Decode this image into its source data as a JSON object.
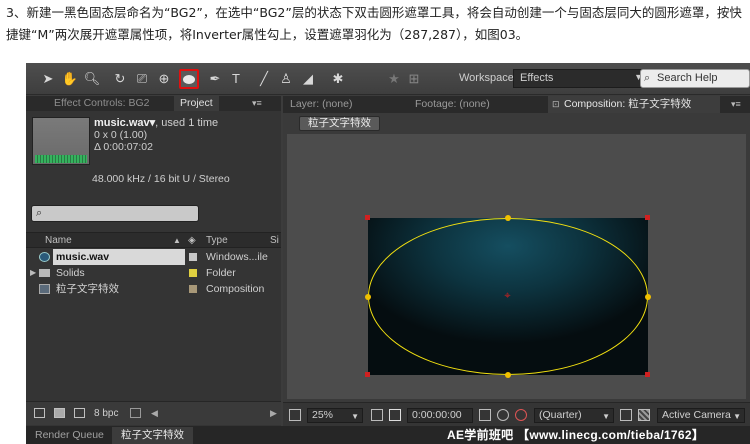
{
  "caption": {
    "line": "3、新建一黑色固态层命名为“BG2”，在选中“BG2”层的状态下双击圆形遮罩工具，将会自动创建一个与固态层同大的圆形遮罩，按快捷键“M”两次展开遮罩属性项，将Inverter属性勾上，设置遮罩羽化为（287,287），如图03。"
  },
  "toolbar": {
    "workspace_label": "Workspace:",
    "workspace_value": "Effects",
    "search_help_placeholder": "Search Help",
    "tools": [
      "selection-tool",
      "hand-tool",
      "zoom-tool",
      "rotate-tool",
      "camera-tool",
      "pan-behind-tool",
      "ellipse-tool",
      "pen-tool",
      "type-tool",
      "brush-tool",
      "clone-stamp-tool",
      "eraser-tool",
      "puppet-tool"
    ]
  },
  "left_panel": {
    "tabs": [
      "Effect Controls: BG2",
      "Project"
    ],
    "active_tab": "Project",
    "file": {
      "name": "music.wav▾",
      "used": ", used 1 time",
      "dimensions": "0 x 0 (1.00)",
      "duration": "Δ 0:00:07:02",
      "audio": "48.000 kHz / 16 bit U / Stereo"
    },
    "columns": {
      "name": "Name",
      "type": "Type",
      "size": "Si"
    },
    "items": [
      {
        "name": "music.wav",
        "type": "Windows...ile",
        "color": "#c8c8c8",
        "icon": "audio-file-icon"
      },
      {
        "name": "Solids",
        "type": "Folder",
        "color": "#e0d040",
        "icon": "folder-icon"
      },
      {
        "name": "粒子文字特效",
        "type": "Composition",
        "color": "#a89878",
        "icon": "composition-icon"
      }
    ],
    "bpc": "8 bpc"
  },
  "right_panel": {
    "tabs": [
      "Layer: (none)",
      "Footage: (none)",
      "Composition: 粒子文字特效"
    ],
    "active_tab": "Composition: 粒子文字特效",
    "comp_chip": "粒子文字特效",
    "viewer_bar": {
      "zoom": "25%",
      "timecode": "0:00:00:00",
      "resolution": "(Quarter)",
      "camera": "Active Camera"
    }
  },
  "bottom_tabs": [
    "Render Queue",
    "粒子文字特效"
  ],
  "watermark": "AE学前班吧  【www.linecg.com/tieba/1762】"
}
